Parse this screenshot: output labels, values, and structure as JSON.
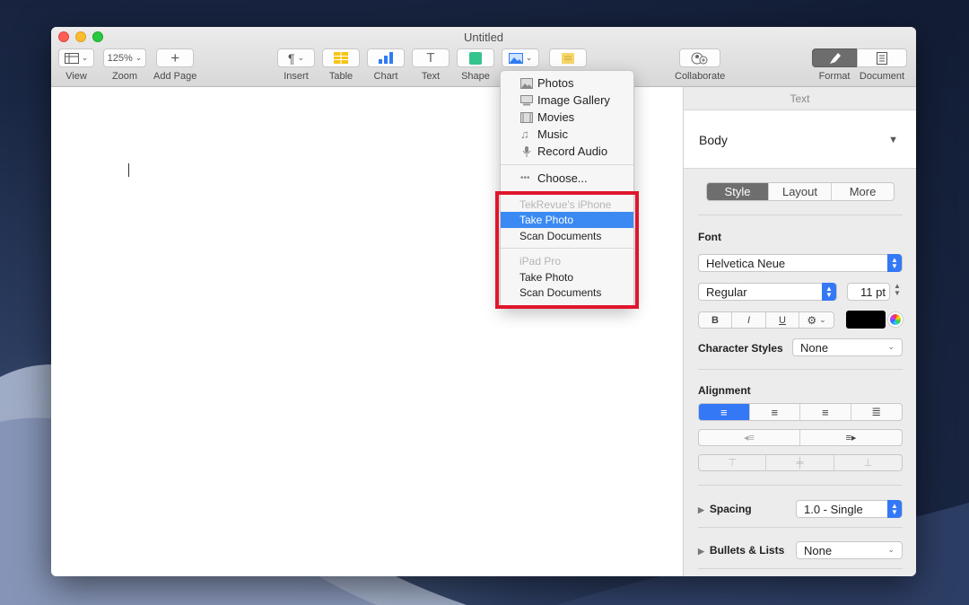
{
  "window": {
    "title": "Untitled"
  },
  "toolbar": {
    "view": {
      "label": "View",
      "icon": "sidebar-view-icon"
    },
    "zoom": {
      "label": "Zoom",
      "value": "125%"
    },
    "add_page": {
      "label": "Add Page",
      "icon": "plus-icon"
    },
    "insert": {
      "label": "Insert",
      "icon": "pilcrow-icon"
    },
    "table": {
      "label": "Table",
      "icon": "table-icon"
    },
    "chart": {
      "label": "Chart",
      "icon": "bar-chart-icon"
    },
    "text": {
      "label": "Text",
      "icon": "text-icon"
    },
    "shape": {
      "label": "Shape",
      "icon": "shape-icon"
    },
    "media": {
      "icon": "photo-icon"
    },
    "comment": {
      "icon": "comment-icon"
    },
    "collaborate": {
      "label": "Collaborate",
      "icon": "collaborate-icon"
    },
    "format": {
      "label": "Format",
      "icon": "paintbrush-icon"
    },
    "document": {
      "label": "Document",
      "icon": "document-icon"
    }
  },
  "media_menu": {
    "items": [
      {
        "label": "Photos",
        "icon": "photos-icon"
      },
      {
        "label": "Image Gallery",
        "icon": "image-gallery-icon"
      },
      {
        "label": "Movies",
        "icon": "movies-icon"
      },
      {
        "label": "Music",
        "icon": "music-icon"
      },
      {
        "label": "Record Audio",
        "icon": "microphone-icon"
      }
    ],
    "choose": "Choose...",
    "devices": [
      {
        "name": "TekRevue's iPhone",
        "actions": [
          "Take Photo",
          "Scan Documents"
        ],
        "selected": "Take Photo"
      },
      {
        "name": "iPad Pro",
        "actions": [
          "Take Photo",
          "Scan Documents"
        ]
      }
    ]
  },
  "sidebar": {
    "header": "Text",
    "paragraph_style": "Body",
    "tabs": [
      "Style",
      "Layout",
      "More"
    ],
    "active_tab": "Style",
    "font_heading": "Font",
    "font_family": "Helvetica Neue",
    "font_typeface": "Regular",
    "font_size": "11 pt",
    "bold_label": "B",
    "italic_label": "I",
    "underline_label": "U",
    "text_color": "#000000",
    "character_styles_label": "Character Styles",
    "character_styles_value": "None",
    "alignment_heading": "Alignment",
    "spacing_label": "Spacing",
    "spacing_value": "1.0 - Single",
    "bullets_label": "Bullets & Lists",
    "bullets_value": "None"
  },
  "colors": {
    "accent": "#3478f6",
    "highlight_box": "#e0162b",
    "selection": "#3b8af3"
  }
}
